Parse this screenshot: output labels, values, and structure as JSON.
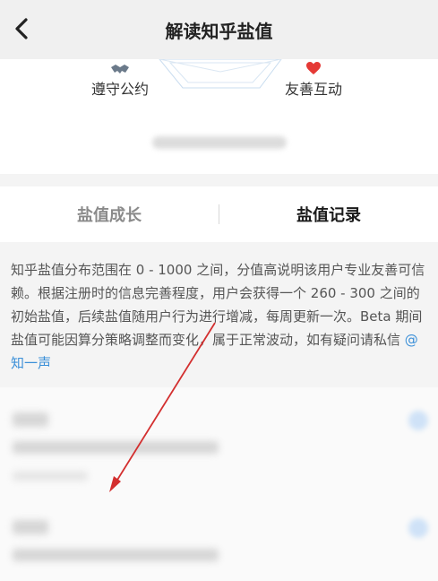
{
  "header": {
    "title": "解读知乎盐值",
    "back_icon": "chevron-left-icon"
  },
  "radar": {
    "left_trait": {
      "label": "遵守公约",
      "icon": "handshake-icon"
    },
    "right_trait": {
      "label": "友善互动",
      "icon": "heart-icon"
    },
    "heart_color": "#e53935",
    "handshake_color": "#6b7a8a"
  },
  "tabs": {
    "growth_label": "盐值成长",
    "records_label": "盐值记录",
    "active": "records"
  },
  "description": {
    "text": "知乎盐值分布范围在 0 - 1000 之间，分值高说明该用户专业友善可信赖。根据注册时的信息完善程度，用户会获得一个 260 - 300 之间的初始盐值，后续盐值随用户行为进行增减，每周更新一次。Beta 期间盐值可能因算分策略调整而变化，属于正常波动，如有疑问请私信 ",
    "mention": "@知一声"
  },
  "colors": {
    "link": "#3a8fd8",
    "annotation_arrow": "#d32f2f"
  }
}
